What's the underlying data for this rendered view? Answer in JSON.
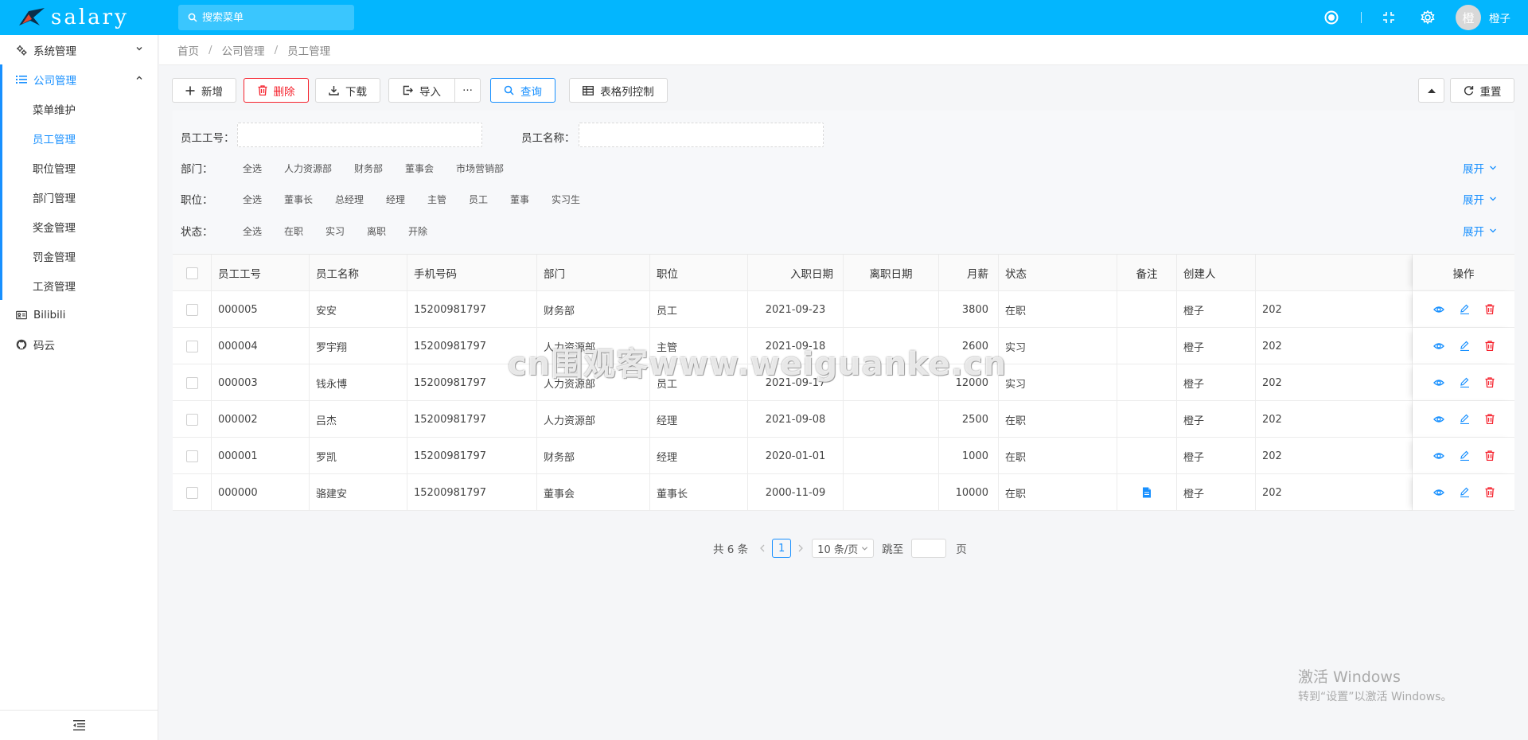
{
  "app": {
    "logo_text": "salary"
  },
  "topbar": {
    "search_placeholder": "搜索菜单",
    "user_avatar": "橙",
    "user_name": "橙子"
  },
  "sidebar": {
    "menus": [
      {
        "label": "系统管理",
        "icon": "gears-icon"
      },
      {
        "label": "公司管理",
        "icon": "list-icon"
      },
      {
        "label": "Bilibili",
        "icon": "id-card-icon"
      },
      {
        "label": "码云",
        "icon": "github-icon"
      }
    ],
    "company_items": [
      "菜单维护",
      "员工管理",
      "职位管理",
      "部门管理",
      "奖金管理",
      "罚金管理",
      "工资管理"
    ],
    "active_item": "员工管理"
  },
  "breadcrumb": [
    "首页",
    "公司管理",
    "员工管理"
  ],
  "toolbar": {
    "add": "新增",
    "delete": "删除",
    "download": "下载",
    "import": "导入",
    "more": "···",
    "query": "查询",
    "columns": "表格列控制",
    "reset": "重置"
  },
  "filter": {
    "emp_no_label": "员工工号：",
    "emp_name_label": "员工名称：",
    "dept_label": "部门：",
    "dept_options": [
      "全选",
      "人力资源部",
      "财务部",
      "董事会",
      "市场营销部"
    ],
    "position_label": "职位：",
    "position_options": [
      "全选",
      "董事长",
      "总经理",
      "经理",
      "主管",
      "员工",
      "董事",
      "实习生"
    ],
    "status_label": "状态：",
    "status_options": [
      "全选",
      "在职",
      "实习",
      "离职",
      "开除"
    ],
    "expand": "展开"
  },
  "table": {
    "headers": [
      "员工工号",
      "员工名称",
      "手机号码",
      "部门",
      "职位",
      "入职日期",
      "离职日期",
      "月薪",
      "状态",
      "备注",
      "创建人",
      "操作"
    ],
    "rows": [
      [
        "000005",
        "安安",
        "15200981797",
        "财务部",
        "员工",
        "2021-09-23",
        "",
        "3800",
        "在职",
        "",
        "橙子",
        "202"
      ],
      [
        "000004",
        "罗宇翔",
        "15200981797",
        "人力资源部",
        "主管",
        "2021-09-18",
        "",
        "2600",
        "实习",
        "",
        "橙子",
        "202"
      ],
      [
        "000003",
        "钱永博",
        "15200981797",
        "人力资源部",
        "员工",
        "2021-09-17",
        "",
        "12000",
        "实习",
        "",
        "橙子",
        "202"
      ],
      [
        "000002",
        "吕杰",
        "15200981797",
        "人力资源部",
        "经理",
        "2021-09-08",
        "",
        "2500",
        "在职",
        "",
        "橙子",
        "202"
      ],
      [
        "000001",
        "罗凯",
        "15200981797",
        "财务部",
        "经理",
        "2020-01-01",
        "",
        "1000",
        "在职",
        "",
        "橙子",
        "202"
      ],
      [
        "000000",
        "骆建安",
        "15200981797",
        "董事会",
        "董事长",
        "2000-11-09",
        "",
        "10000",
        "在职",
        "note-file-icon",
        "橙子",
        "202"
      ]
    ]
  },
  "pagination": {
    "total": "共 6 条",
    "current": "1",
    "page_size": "10 条/页",
    "jump_label": "跳至",
    "page_unit": "页"
  },
  "overlay": {
    "watermark": "cn围观客www.weiguanke.cn",
    "activate_title": "激活 Windows",
    "activate_sub": "转到“设置”以激活 Windows。"
  },
  "colors": {
    "accent": "#03b6fe",
    "primary": "#1890ff",
    "danger": "#f5222d"
  }
}
